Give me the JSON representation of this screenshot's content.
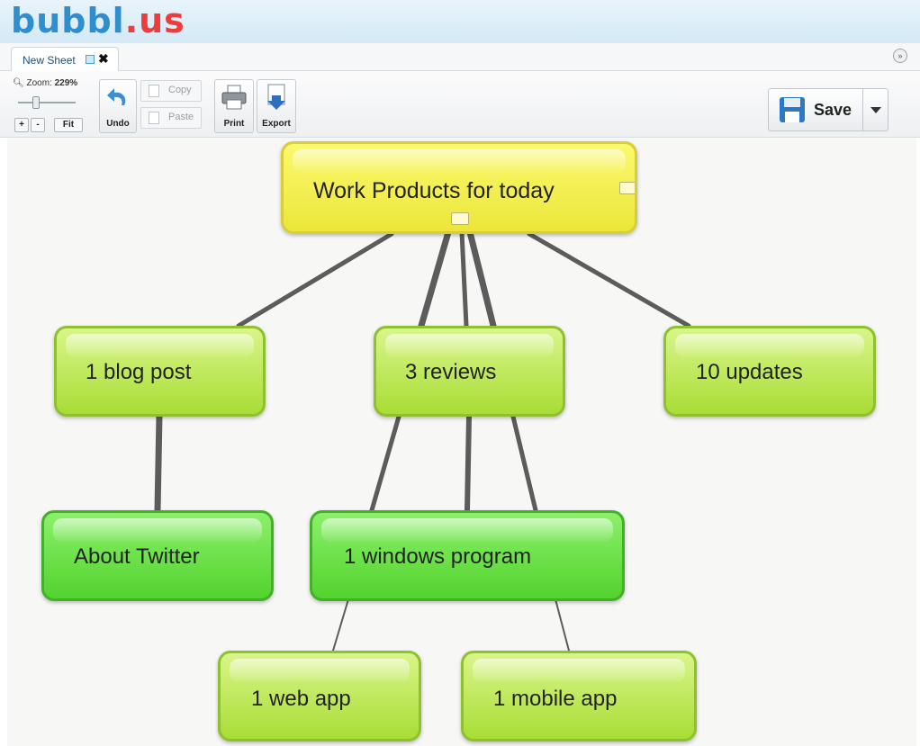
{
  "app": {
    "logo_part1": "bubbl",
    "logo_part2": ".us"
  },
  "tabs": [
    {
      "label": "New Sheet"
    }
  ],
  "toolbar": {
    "zoom_label": "Zoom:",
    "zoom_value": "229%",
    "zoom_in": "+",
    "zoom_out": "-",
    "fit": "Fit",
    "undo": "Undo",
    "copy": "Copy",
    "paste": "Paste",
    "print": "Print",
    "export": "Export",
    "save": "Save"
  },
  "mindmap": {
    "root": "Work Products for today",
    "nodes": {
      "blog": "1 blog post",
      "reviews": "3 reviews",
      "updates": "10 updates",
      "twitter": "About Twitter",
      "windows": "1 windows program",
      "webapp": "1 web app",
      "mobile": "1 mobile app"
    }
  },
  "colors": {
    "root_fill": "#f3ef52",
    "child_fill": "#c2ea5b",
    "leaf_fill": "#6de24a",
    "connector": "#5a5a5a"
  }
}
